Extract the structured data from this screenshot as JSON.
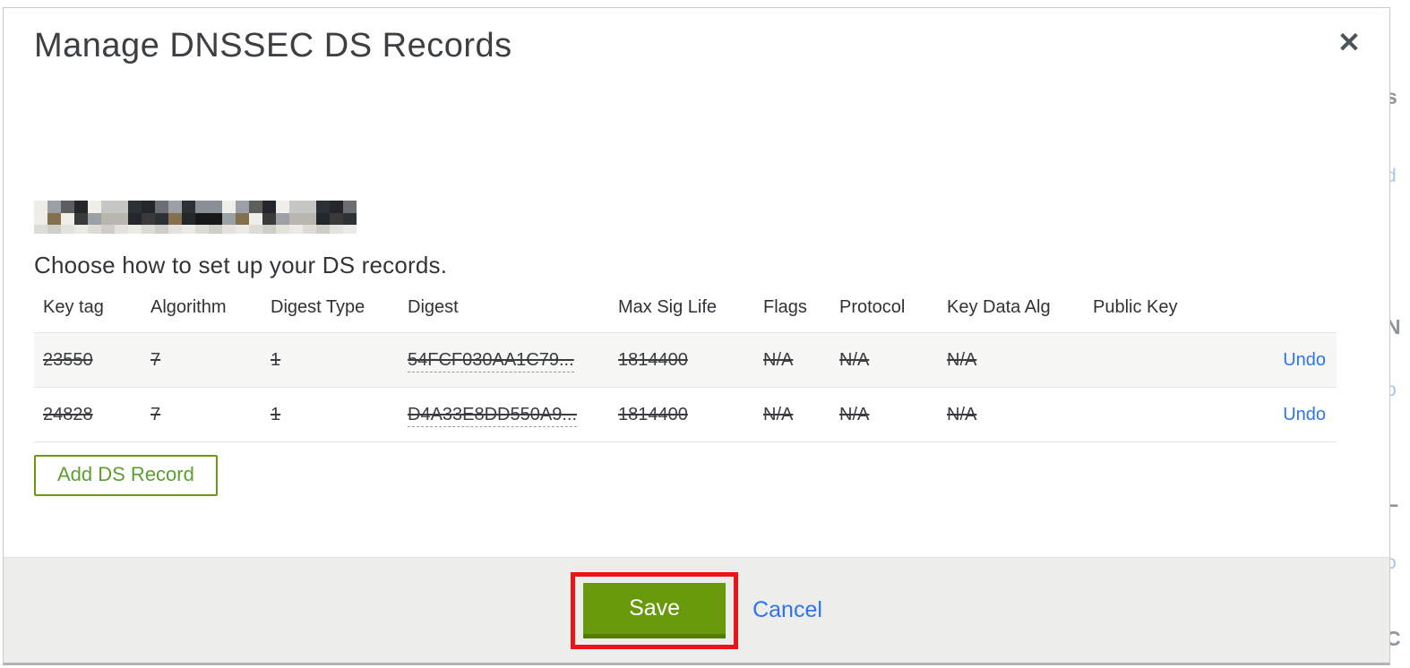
{
  "modal": {
    "title": "Manage DNSSEC DS Records",
    "close_label": "✕",
    "instruction": "Choose how to set up your DS records.",
    "table": {
      "headers": [
        "Key tag",
        "Algorithm",
        "Digest Type",
        "Digest",
        "Max Sig Life",
        "Flags",
        "Protocol",
        "Key Data Alg",
        "Public Key"
      ],
      "rows": [
        {
          "key_tag": "23550",
          "algorithm": "7",
          "digest_type": "1",
          "digest": "54FCF030AA1C79...",
          "max_sig_life": "1814400",
          "flags": "N/A",
          "protocol": "N/A",
          "key_data_alg": "N/A",
          "public_key": "",
          "action_label": "Undo",
          "state": "marked-for-deletion"
        },
        {
          "key_tag": "24828",
          "algorithm": "7",
          "digest_type": "1",
          "digest": "D4A33E8DD550A9...",
          "max_sig_life": "1814400",
          "flags": "N/A",
          "protocol": "N/A",
          "key_data_alg": "N/A",
          "public_key": "",
          "action_label": "Undo",
          "state": "marked-for-deletion"
        }
      ]
    },
    "add_record_label": "Add DS Record",
    "footer": {
      "save_label": "Save",
      "cancel_label": "Cancel"
    }
  },
  "colors": {
    "link_blue": "#2e73f1",
    "save_green": "#68990b",
    "save_green_dark": "#517c00",
    "annotation_red": "#ec1414",
    "add_border_green": "#6b9b0d",
    "add_text_green": "#5d9e31"
  },
  "redacted_domain_mosaic": {
    "palette": [
      "#f0eee9",
      "#3a3a3a",
      "#181818",
      "#6b6e72",
      "#9aa0a6",
      "#c6c6c4",
      "#4e5459",
      "#2c3136",
      "#84704f",
      "#b9b6ae",
      "#5d5d5d",
      "#23272b",
      "#8a8f96",
      "#d8d6d0"
    ],
    "light_palette": [
      "#eceae5",
      "#dddbd6",
      "#cfcdc8",
      "#e4e2dd"
    ]
  },
  "background_sliver": {
    "fragments": [
      "s",
      "d",
      "N",
      "o",
      "L",
      "o",
      "C"
    ]
  }
}
